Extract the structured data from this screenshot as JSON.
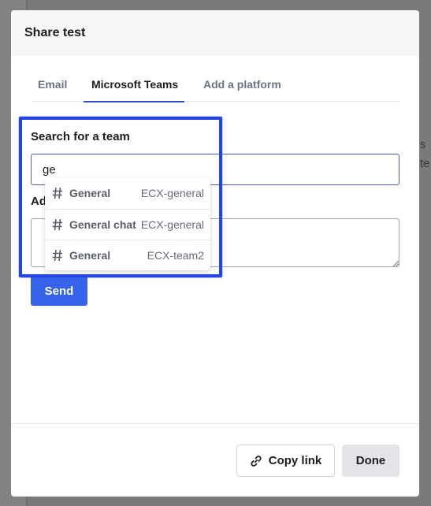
{
  "background": {
    "right_text_lines": [
      "s",
      "te"
    ]
  },
  "modal": {
    "title": "Share test",
    "tabs": [
      {
        "label": "Email",
        "active": false
      },
      {
        "label": "Microsoft Teams",
        "active": true
      },
      {
        "label": "Add a platform",
        "active": false
      }
    ],
    "search": {
      "label": "Search for a team",
      "value": "ge",
      "placeholder": ""
    },
    "add_label": "Ad",
    "message": {
      "value": ""
    },
    "send_label": "Send",
    "footer": {
      "copy_link_label": "Copy link",
      "done_label": "Done"
    }
  },
  "dropdown": {
    "items": [
      {
        "name": "General",
        "team": "ECX-general"
      },
      {
        "name": "General chat",
        "team": "ECX-general"
      },
      {
        "name": "General",
        "team": "ECX-team2"
      }
    ]
  },
  "colors": {
    "accent": "#3563e9",
    "highlight": "#2346e0",
    "active_tab": "#2d4cc8",
    "overlay_background": "#7a7a7a"
  },
  "icons": [
    "hash-icon",
    "link-icon",
    "resize-grip-icon"
  ]
}
